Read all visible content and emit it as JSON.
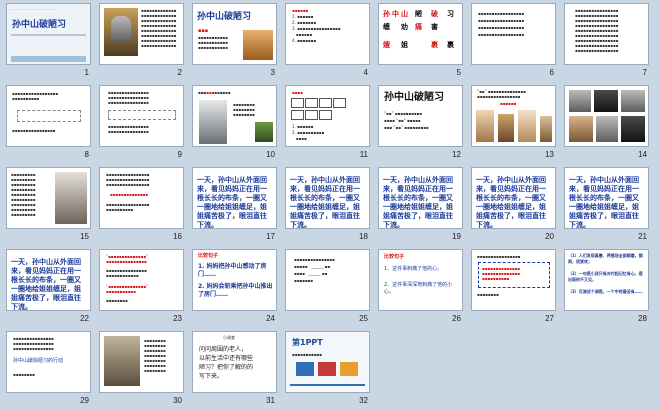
{
  "slides": [
    {
      "n": "1",
      "title": "孙中山破陋习"
    },
    {
      "n": "2"
    },
    {
      "n": "3",
      "title": "孙中山破陋习"
    },
    {
      "n": "4"
    },
    {
      "n": "5",
      "chars": [
        "孙",
        "中",
        "山",
        "陋",
        "习",
        "破",
        "缠",
        "裹",
        "嫂",
        "姐",
        "痛",
        "害",
        "劝",
        "裹"
      ]
    },
    {
      "n": "6"
    },
    {
      "n": "7"
    },
    {
      "n": "8"
    },
    {
      "n": "9"
    },
    {
      "n": "10"
    },
    {
      "n": "11"
    },
    {
      "n": "12",
      "title": "孙中山破陋习"
    },
    {
      "n": "13"
    },
    {
      "n": "14"
    },
    {
      "n": "15"
    },
    {
      "n": "16"
    },
    {
      "n": "17",
      "para": "一天，孙中山从外面回来，看见妈妈正在用一根长长的布条，一圈又一圈地给姐姐缠足，姐姐痛苦极了，眼泪直往下流。"
    },
    {
      "n": "18",
      "para": "一天，孙中山从外面回来，看见妈妈正在用一根长长的布条，一圈又一圈地给姐姐缠足，姐姐痛苦极了，眼泪直往下流。"
    },
    {
      "n": "19",
      "para": "一天，孙中山从外面回来，看见妈妈正在用一根长长的布条，一圈又一圈地给姐姐缠足，姐姐痛苦极了，眼泪直往下流。"
    },
    {
      "n": "20",
      "para": "一天，孙中山从外面回来，看见妈妈正在用一根长长的布条，一圈又一圈地给姐姐缠足，姐姐痛苦极了，眼泪直往下流。"
    },
    {
      "n": "21",
      "para": "一天，孙中山从外面回来，看见妈妈正在用一根长长的布条，一圈又一圈地给姐姐缠足，姐姐痛苦极了，眼泪直往下流。"
    },
    {
      "n": "22",
      "para": "一天，孙中山从外面回来，看见妈妈正在用一根长长的布条，一圈又一圈地给姐姐缠足，姐姐痛苦极了，眼泪直往下流。"
    },
    {
      "n": "23"
    },
    {
      "n": "24",
      "heading": "比较句子",
      "lines": [
        "1. 妈妈把孙中山感动了房门……",
        "2. 妈妈会斩乘把孙中山推出了房门……"
      ]
    },
    {
      "n": "25"
    },
    {
      "n": "26",
      "heading": "比较句子",
      "lines": [
        "1、这件事刺痛了他的心。",
        "2、这件事深深地刺痛了他的小心。"
      ]
    },
    {
      "n": "27"
    },
    {
      "n": "28",
      "lines": [
        "（1）人们发现真善、养殖场全部都着，都同，欣赏欢；",
        "（2）一句是小孩只有对付起记忆有心，是出现的不又见，",
        "（3）可测试个调是，一个中时最没有……"
      ]
    },
    {
      "n": "29",
      "lines": [
        "孙中山破除陋习的行动"
      ]
    },
    {
      "n": "30"
    },
    {
      "n": "31",
      "heading": "小调查",
      "lines": [
        "问问周围的老人，",
        "以前生活中还有哪些",
        "陋习？把你了解的的",
        "写下来。"
      ]
    },
    {
      "n": "32",
      "logo": "第1PPT"
    }
  ]
}
